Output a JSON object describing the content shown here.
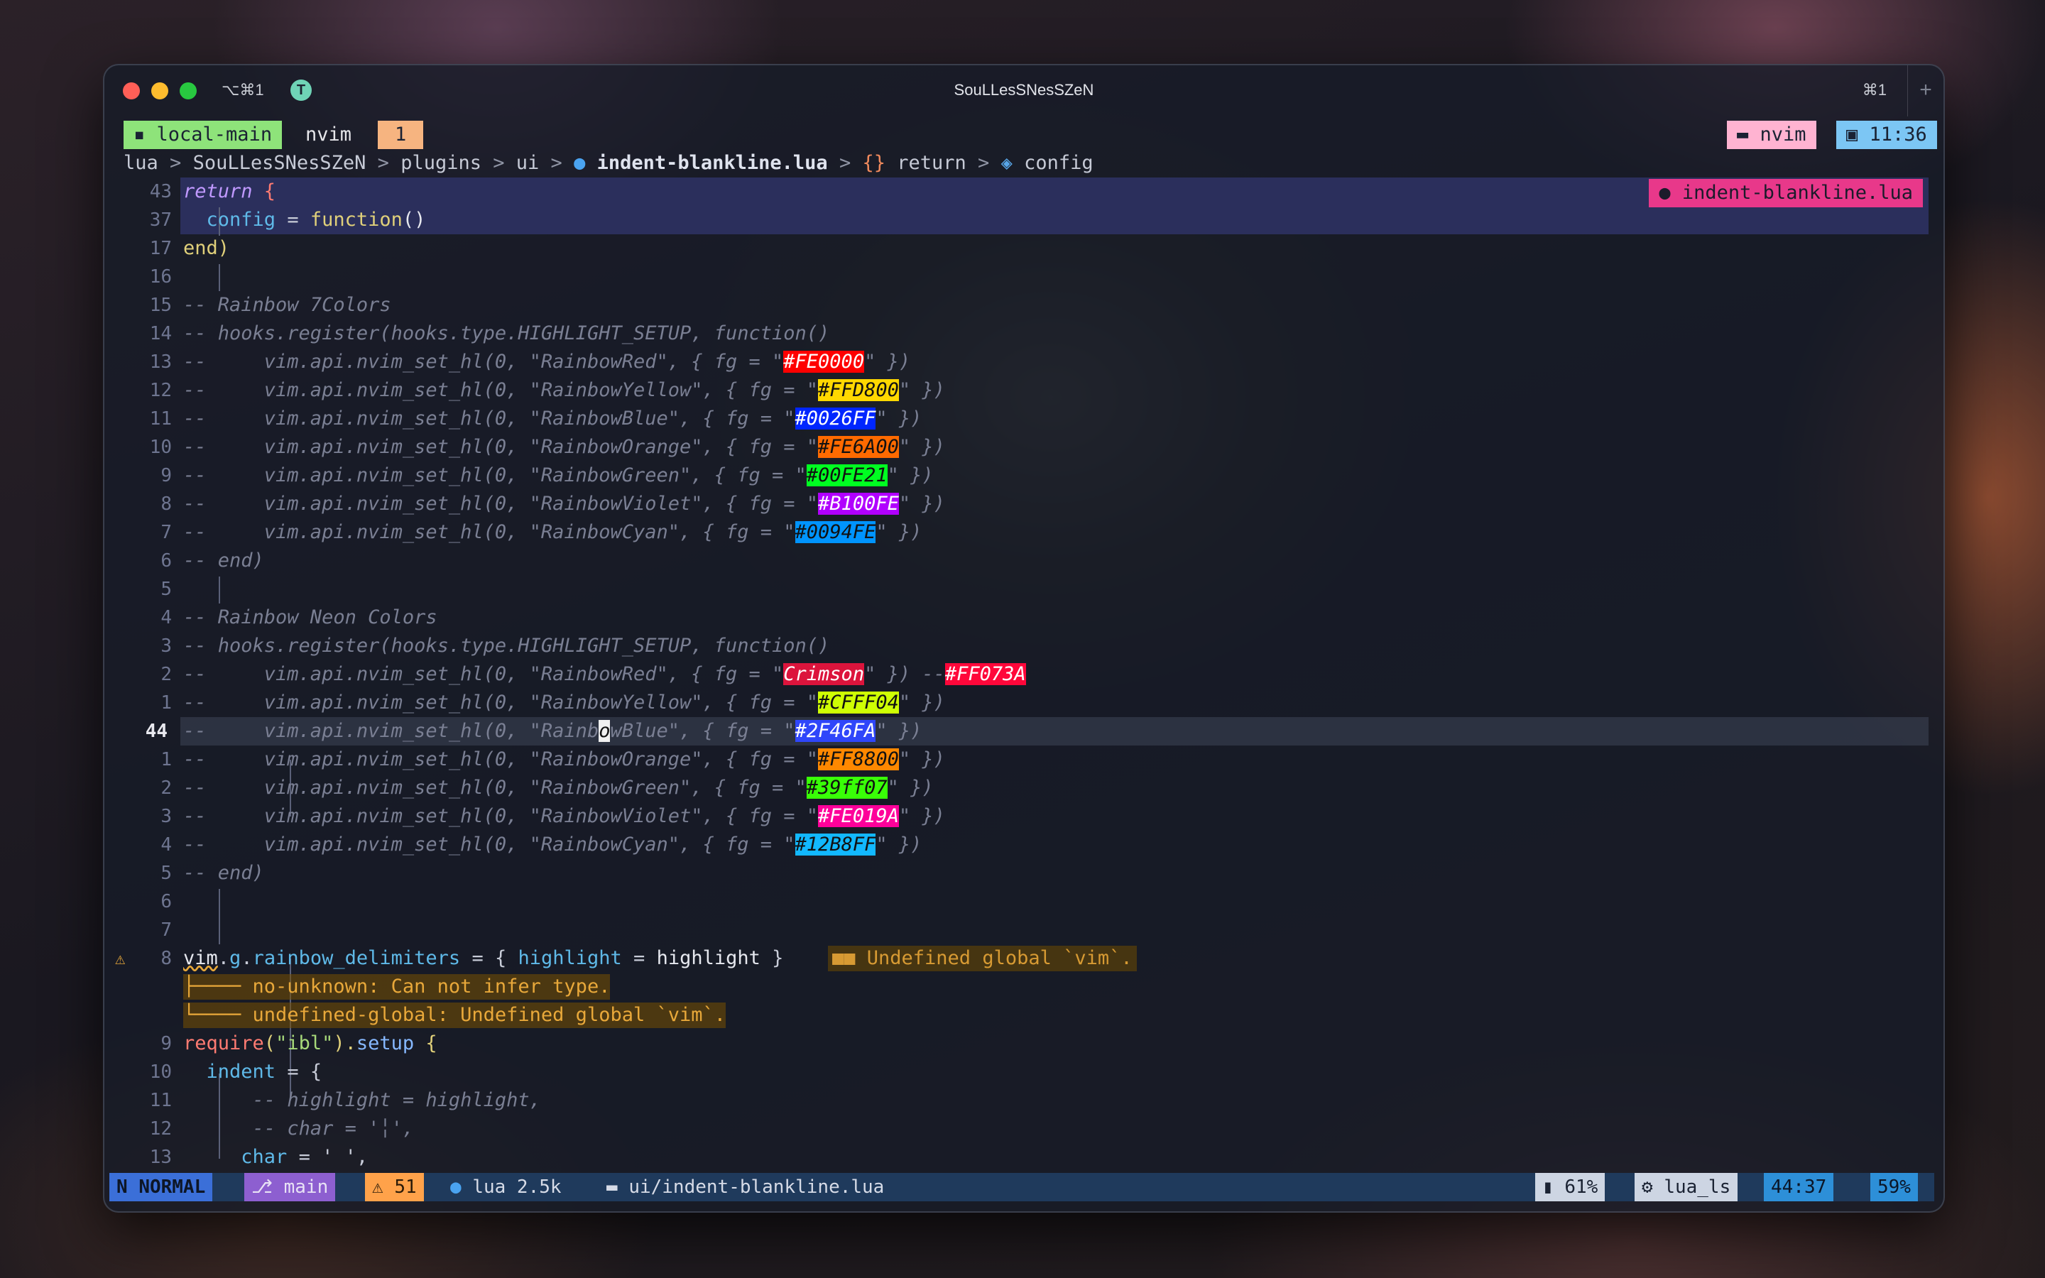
{
  "window": {
    "tab_key": "⌥⌘1",
    "title": "SouLLesSNesSZeN",
    "tab_right": "⌘1",
    "app_icon": "T"
  },
  "tmux": {
    "session": "local-main",
    "window": "nvim",
    "number": "1",
    "pane": "nvim",
    "clock": "11:36"
  },
  "breadcrumb": [
    "lua",
    "SouLLesSNesSZeN",
    "plugins",
    "ui",
    "indent-blankline.lua",
    "return",
    "config"
  ],
  "float_tag": "indent-blankline.lua",
  "lines": {
    "n43": "43",
    "n37": "37",
    "n17": "17",
    "n16": "16",
    "n15": "15",
    "n14": "14",
    "n13": "13",
    "n12": "12",
    "n11": "11",
    "n10": "10",
    "n9": "9",
    "n8": "8",
    "n7": "7",
    "n6": "6",
    "n5": "5",
    "n4": "4",
    "n3": "3",
    "n2": "2",
    "n1": "1",
    "n44": "44",
    "a1": "1",
    "a2": "2",
    "a3": "3",
    "a4": "4",
    "a5": "5",
    "a6": "6",
    "a7": "7",
    "a8": "8",
    "a9": "9",
    "a10": "10",
    "a11": "11",
    "a12": "12",
    "a13": "13"
  },
  "code": {
    "l0_a": "return",
    "l0_b": " {",
    "l1_a": "config",
    "l1_b": " = ",
    "l1_c": "function",
    "l1_d": "()",
    "l2": "end)",
    "l4": "-- Rainbow 7Colors",
    "l5": "-- hooks.register(hooks.type.HIGHLIGHT_SETUP, function()",
    "red7_pre": "--     vim.api.nvim_set_hl(0, \"RainbowRed\", { fg = \"",
    "red7_val": "#FE0000",
    "red7_post": "\" })",
    "yel7_pre": "--     vim.api.nvim_set_hl(0, \"RainbowYellow\", { fg = \"",
    "yel7_val": "#FFD800",
    "yel7_post": "\" })",
    "blu7_pre": "--     vim.api.nvim_set_hl(0, \"RainbowBlue\", { fg = \"",
    "blu7_val": "#0026FF",
    "blu7_post": "\" })",
    "ora7_pre": "--     vim.api.nvim_set_hl(0, \"RainbowOrange\", { fg = \"",
    "ora7_val": "#FE6A00",
    "ora7_post": "\" })",
    "gre7_pre": "--     vim.api.nvim_set_hl(0, \"RainbowGreen\", { fg = \"",
    "gre7_val": "#00FE21",
    "gre7_post": "\" })",
    "vio7_pre": "--     vim.api.nvim_set_hl(0, \"RainbowViolet\", { fg = \"",
    "vio7_val": "#B100FE",
    "vio7_post": "\" })",
    "cya7_pre": "--     vim.api.nvim_set_hl(0, \"RainbowCyan\", { fg = \"",
    "cya7_val": "#0094FE",
    "cya7_post": "\" })",
    "end7": "-- end)",
    "neon_h": "-- Rainbow Neon Colors",
    "neon_reg": "-- hooks.register(hooks.type.HIGHLIGHT_SETUP, function()",
    "redN_pre": "--     vim.api.nvim_set_hl(0, \"RainbowRed\", { fg = \"",
    "redN_val": "Crimson",
    "redN_post": "\" }) --",
    "redN_extra": "#FF073A",
    "yelN_pre": "--     vim.api.nvim_set_hl(0, \"RainbowYellow\", { fg = \"",
    "yelN_val": "#CFFF04",
    "yelN_post": "\" })",
    "bluN_pre1": "--     vim.api.nvim_set_hl(0, \"Rainb",
    "bluN_cur": "o",
    "bluN_pre2": "wBlue\", { fg = \"",
    "bluN_val": "#2F46FA",
    "bluN_post": "\" })",
    "oraN_pre": "--     vim.api.nvim_set_hl(0, \"RainbowOrange\", { fg = \"",
    "oraN_val": "#FF8800",
    "oraN_post": "\" })",
    "greN_pre": "--     vim.api.nvim_set_hl(0, \"RainbowGreen\", { fg = \"",
    "greN_val": "#39ff07",
    "greN_post": "\" })",
    "vioN_pre": "--     vim.api.nvim_set_hl(0, \"RainbowViolet\", { fg = \"",
    "vioN_val": "#FE019A",
    "vioN_post": "\" })",
    "cyaN_pre": "--     vim.api.nvim_set_hl(0, \"RainbowCyan\", { fg = \"",
    "cyaN_val": "#12B8FF",
    "cyaN_post": "\" })",
    "endN": "-- end)",
    "vim_a": "vim",
    "vim_b": ".",
    "vim_c": "g",
    "vim_d": ".",
    "vim_e": "rainbow_delimiters",
    "vim_f": " = { ",
    "vim_g": "highlight",
    "vim_h": " = ",
    "vim_i": "highlight",
    "vim_j": " }",
    "diag_virtual": "■■ Undefined global `vim`.",
    "diag1": "├──── no-unknown: Can not infer type.",
    "diag2": "└──── undefined-global: Undefined global `vim`.",
    "req_a": "require",
    "req_b": "(",
    "req_c": "\"ibl\"",
    "req_d": ").",
    "req_e": "setup",
    "req_f": " {",
    "ind_a": "indent",
    "ind_b": " = {",
    "hl_cmt": "-- highlight = highlight,",
    "char_cmt": "-- char = '╎',",
    "char_a": "char",
    "char_b": " = ' ',"
  },
  "status": {
    "mode": "NORMAL",
    "branch": "main",
    "warnings": "51",
    "filetype": "lua 2.5k",
    "path": "ui/indent-blankline.lua",
    "battery": "61%",
    "lsp": "lua_ls",
    "position": "44:37",
    "percent": "59%"
  },
  "colors": {
    "swatch_FE0000": "#FE0000",
    "swatch_FFD800": "#FFD800",
    "swatch_0026FF": "#0026FF",
    "swatch_FE6A00": "#FE6A00",
    "swatch_00FE21": "#00FE21",
    "swatch_B100FE": "#B100FE",
    "swatch_0094FE": "#0094FE",
    "swatch_Crimson": "#DC143C",
    "swatch_FF073A": "#FF073A",
    "swatch_CFFF04": "#CFFF04",
    "swatch_2F46FA": "#2F46FA",
    "swatch_FF8800": "#FF8800",
    "swatch_39ff07": "#39ff07",
    "swatch_FE019A": "#FE019A",
    "swatch_12B8FF": "#12B8FF"
  }
}
